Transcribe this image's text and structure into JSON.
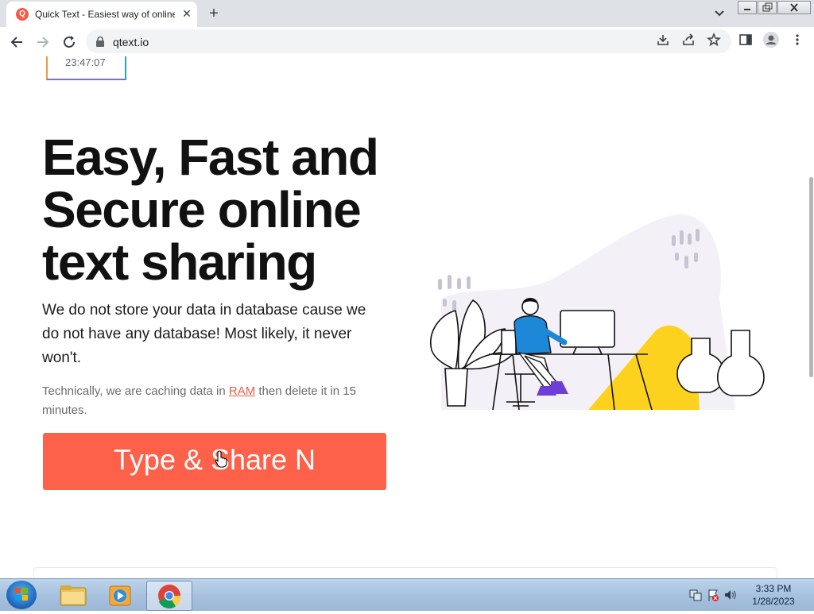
{
  "browser": {
    "tab_title": "Quick Text - Easiest way of online",
    "favicon_letter": "Q",
    "url": "qtext.io"
  },
  "page": {
    "clock_time": "23:47:07",
    "hero_title": "Easy, Fast and Secure online text sharing",
    "lead_text": "We do not store your data in database cause we do not have any database! Most likely, it never won't.",
    "note_prefix": "Technically, we are caching data in ",
    "note_link": "RAM",
    "note_suffix": " then delete it in 15 minutes.",
    "cta_label": "Type & Share N",
    "accent_color": "#fe6149"
  },
  "taskbar": {
    "time": "3:33 PM",
    "date": "1/28/2023",
    "apps": [
      "windows-explorer-icon",
      "media-player-icon",
      "chrome-icon"
    ]
  }
}
